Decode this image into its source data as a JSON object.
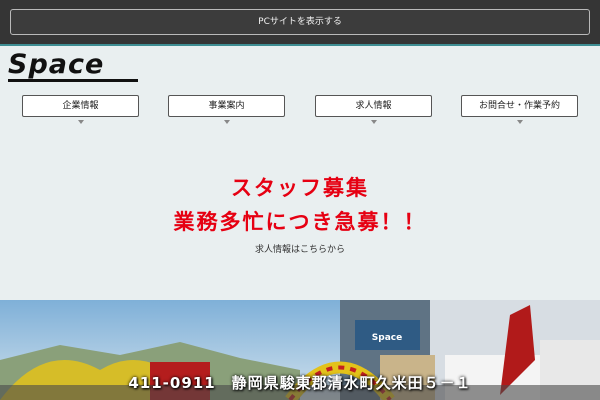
{
  "topbar": {
    "pc_site_button": "PCサイトを表示する"
  },
  "logo": {
    "text": "Space"
  },
  "nav": {
    "items": [
      {
        "label": "企業情報"
      },
      {
        "label": "事業案内"
      },
      {
        "label": "求人情報"
      },
      {
        "label": "お問合せ・作業予約"
      }
    ]
  },
  "recruit": {
    "headline_line1": "スタッフ募集",
    "headline_line2": "業務多忙につき急募！！",
    "link_text": "求人情報はこちらから"
  },
  "hero": {
    "address": "411-0911　静岡県駿東郡清水町久米田５－１"
  },
  "colors": {
    "topbar": "#353535",
    "accent": "#3f8e93",
    "background": "#e9eff0",
    "headline_red": "#e60012"
  },
  "icons": [
    "caret-down-icon"
  ]
}
